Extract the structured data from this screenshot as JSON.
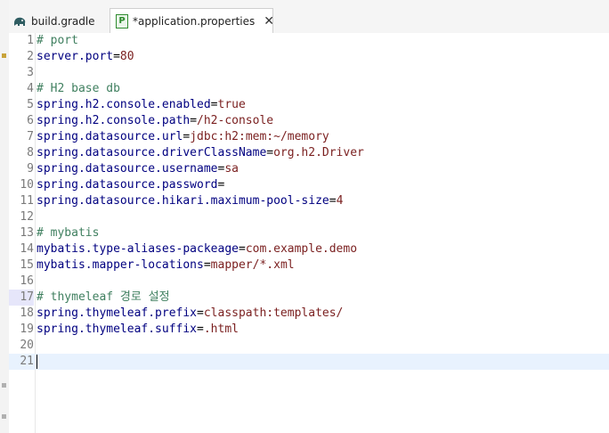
{
  "tabs": [
    {
      "label": "build.gradle",
      "icon": "gradle-elephant-icon",
      "active": false
    },
    {
      "label": "*application.properties",
      "icon": "properties-file-icon",
      "active": true
    }
  ],
  "lines": [
    {
      "n": "1",
      "type": "comment",
      "text": "# port"
    },
    {
      "n": "2",
      "type": "prop",
      "key": "server.port",
      "value": "80"
    },
    {
      "n": "3",
      "type": "blank"
    },
    {
      "n": "4",
      "type": "comment",
      "text": "# H2 base db"
    },
    {
      "n": "5",
      "type": "prop",
      "key": "spring.h2.console.enabled",
      "value": "true"
    },
    {
      "n": "6",
      "type": "prop",
      "key": "spring.h2.console.path",
      "value": "/h2-console"
    },
    {
      "n": "7",
      "type": "prop",
      "key": "spring.datasource.url",
      "value": "jdbc:h2:mem:~/memory"
    },
    {
      "n": "8",
      "type": "prop",
      "key": "spring.datasource.driverClassName",
      "value": "org.h2.Driver"
    },
    {
      "n": "9",
      "type": "prop",
      "key": "spring.datasource.username",
      "value": "sa"
    },
    {
      "n": "10",
      "type": "prop",
      "key": "spring.datasource.password",
      "value": ""
    },
    {
      "n": "11",
      "type": "prop",
      "key": "spring.datasource.hikari.maximum-pool-size",
      "value": "4"
    },
    {
      "n": "12",
      "type": "blank"
    },
    {
      "n": "13",
      "type": "comment",
      "text": "# mybatis"
    },
    {
      "n": "14",
      "type": "prop",
      "key": "mybatis.type-aliases-packeage",
      "value": "com.example.demo"
    },
    {
      "n": "15",
      "type": "prop",
      "key": "mybatis.mapper-locations",
      "value": "mapper/*.xml"
    },
    {
      "n": "16",
      "type": "blank"
    },
    {
      "n": "17",
      "type": "comment",
      "text": "# thymeleaf 경로 설정",
      "marked": true
    },
    {
      "n": "18",
      "type": "prop",
      "key": "spring.thymeleaf.prefix",
      "value": "classpath:templates/"
    },
    {
      "n": "19",
      "type": "prop",
      "key": "spring.thymeleaf.suffix",
      "value": ".html"
    },
    {
      "n": "20",
      "type": "blank"
    },
    {
      "n": "21",
      "type": "blank",
      "current": true
    }
  ],
  "equals_sign": "=",
  "colors": {
    "comment": "#3f7f5f",
    "key": "#000080",
    "value": "#7a1f1f",
    "current_line": "#e8f2fe"
  }
}
